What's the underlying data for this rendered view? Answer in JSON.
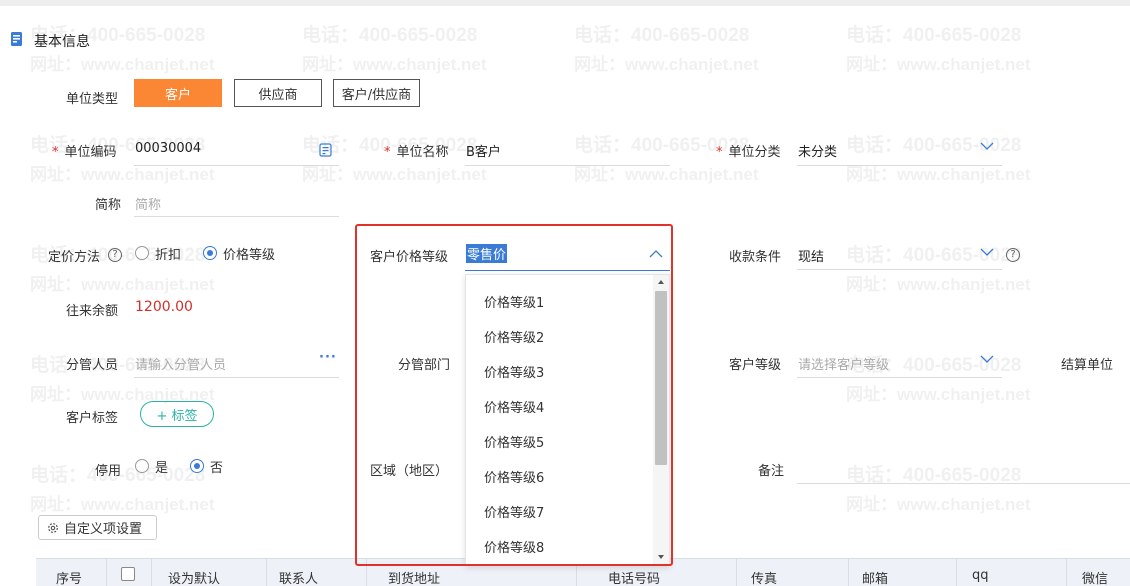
{
  "section": {
    "title": "基本信息"
  },
  "watermark": {
    "phone": "电话：400-665-0028",
    "url": "网址：www.chanjet.net"
  },
  "unit_type": {
    "label": "单位类型",
    "options": [
      "客户",
      "供应商",
      "客户/供应商"
    ],
    "selected": "客户"
  },
  "unit_code": {
    "label": "单位编码",
    "value": "00030004"
  },
  "unit_name": {
    "label": "单位名称",
    "value": "B客户"
  },
  "unit_category": {
    "label": "单位分类",
    "value": "未分类"
  },
  "short_name": {
    "label": "简称",
    "placeholder": "简称"
  },
  "pricing_method": {
    "label": "定价方法",
    "options": [
      "折扣",
      "价格等级"
    ],
    "selected": "价格等级"
  },
  "customer_price_level": {
    "label": "客户价格等级",
    "value": "零售价"
  },
  "payment_terms": {
    "label": "收款条件",
    "value": "现结"
  },
  "balance": {
    "label": "往来余额",
    "value": "1200.00"
  },
  "manager": {
    "label": "分管人员",
    "placeholder": "请输入分管人员"
  },
  "department": {
    "label": "分管部门"
  },
  "customer_grade": {
    "label": "客户等级",
    "placeholder": "请选择客户等级"
  },
  "settlement_unit": {
    "label": "结算单位"
  },
  "customer_tags": {
    "label": "客户标签",
    "button": "+ 标签"
  },
  "disabled": {
    "label": "停用",
    "options": [
      "是",
      "否"
    ],
    "selected": "否"
  },
  "region": {
    "label": "区域（地区）"
  },
  "remark": {
    "label": "备注"
  },
  "custom_settings": {
    "label": "自定义项设置"
  },
  "price_level_options": [
    "价格等级1",
    "价格等级2",
    "价格等级3",
    "价格等级4",
    "价格等级5",
    "价格等级6",
    "价格等级7",
    "价格等级8"
  ],
  "table": {
    "headers": [
      "序号",
      "设为默认",
      "联系人",
      "到货地址",
      "电话号码",
      "传真",
      "邮箱",
      "qq",
      "微信"
    ]
  },
  "colors": {
    "accent": "#fb8633",
    "required": "#e0322b",
    "radio": "#3a7bd5",
    "balance": "#d0312d",
    "tag": "#2bb3a3"
  }
}
